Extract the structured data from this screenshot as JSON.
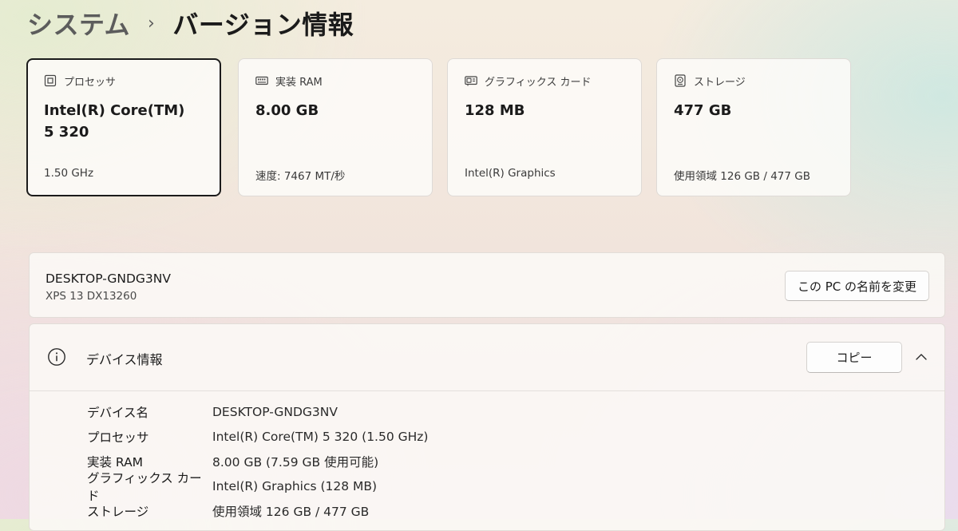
{
  "breadcrumb": {
    "parent": "システム",
    "separator": "›",
    "current": "バージョン情報"
  },
  "cards": [
    {
      "title": "プロセッサ",
      "icon": "processor-icon",
      "value": "Intel(R) Core(TM) 5 320",
      "sub": "1.50 GHz",
      "selected": true
    },
    {
      "title": "実装 RAM",
      "icon": "ram-icon",
      "value": "8.00 GB",
      "sub": "速度: 7467 MT/秒",
      "selected": false
    },
    {
      "title": "グラフィックス カード",
      "icon": "graphics-card-icon",
      "value": "128 MB",
      "sub": "Intel(R) Graphics",
      "selected": false
    },
    {
      "title": "ストレージ",
      "icon": "storage-icon",
      "value": "477 GB",
      "sub": "使用領域 126 GB / 477 GB",
      "selected": false
    }
  ],
  "device": {
    "name": "DESKTOP-GNDG3NV",
    "model": "XPS 13 DX13260",
    "rename_label": "この PC の名前を変更"
  },
  "device_info": {
    "title": "デバイス情報",
    "copy_label": "コピー",
    "rows": [
      {
        "label": "デバイス名",
        "value": "DESKTOP-GNDG3NV"
      },
      {
        "label": "プロセッサ",
        "value": "Intel(R) Core(TM) 5 320 (1.50 GHz)"
      },
      {
        "label": "実装 RAM",
        "value": "8.00 GB (7.59 GB 使用可能)"
      },
      {
        "label": "グラフィックス カード",
        "value": "Intel(R) Graphics (128 MB)"
      },
      {
        "label": "ストレージ",
        "value": "使用領域 126 GB / 477 GB"
      }
    ]
  }
}
